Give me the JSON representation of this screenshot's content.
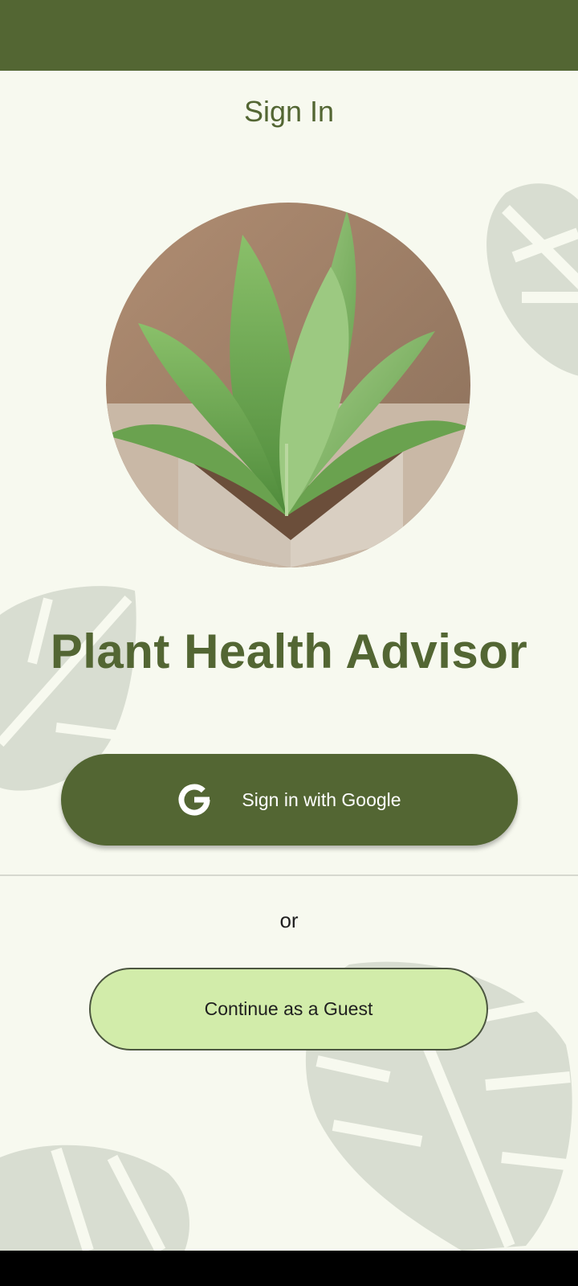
{
  "header": {
    "title": "Sign In"
  },
  "app": {
    "name": "Plant Health Advisor"
  },
  "actions": {
    "google_label": "Sign in with Google",
    "or_label": "or",
    "guest_label": "Continue as a Guest"
  },
  "icons": {
    "google": "google-g-icon",
    "hero": "potted-plant-image",
    "background": "monstera-leaf-decoration"
  },
  "colors": {
    "primary": "#536633",
    "background": "#f7f9ef",
    "guest_button": "#d2ecaa",
    "on_primary": "#ffffff"
  }
}
